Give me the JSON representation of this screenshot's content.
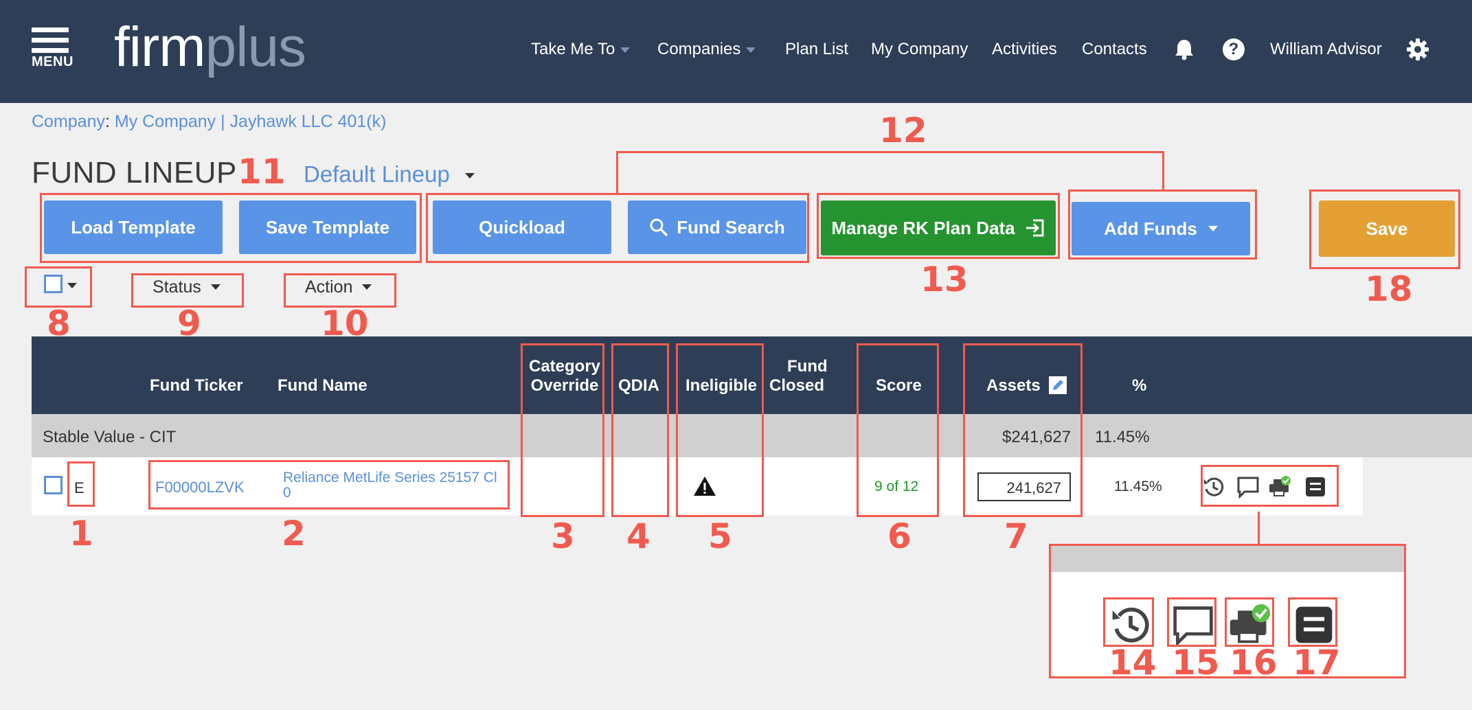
{
  "header": {
    "menu_label": "MENU",
    "logo_firm": "firm",
    "logo_plus": "plus",
    "nav": {
      "take_me_to": "Take Me To",
      "companies": "Companies",
      "plan_list": "Plan List",
      "my_company": "My Company",
      "activities": "Activities",
      "contacts": "Contacts",
      "user": "William Advisor"
    },
    "help_glyph": "?",
    "icons": [
      "menu-icon",
      "bell-icon",
      "help-icon",
      "gear-icon"
    ]
  },
  "breadcrumb": {
    "label": "Company",
    "separator": ":",
    "value": "My Company | Jayhawk LLC 401(k)"
  },
  "page": {
    "title": "FUND LINEUP",
    "lineup_selector": "Default Lineup"
  },
  "toolbar": {
    "load_template": "Load Template",
    "save_template": "Save Template",
    "quickload": "Quickload",
    "fund_search": "Fund Search",
    "manage_rk": "Manage RK Plan Data",
    "add_funds": "Add Funds",
    "save": "Save"
  },
  "filters": {
    "status": "Status",
    "action": "Action"
  },
  "table": {
    "headers": {
      "ticker": "Fund Ticker",
      "name": "Fund Name",
      "category_override_1": "Category",
      "category_override_2": "Override",
      "qdia": "QDIA",
      "ineligible": "Ineligible",
      "fund_closed_1": "Fund",
      "fund_closed_2": "Closed",
      "score": "Score",
      "assets": "Assets",
      "percent": "%"
    },
    "group": {
      "name": "Stable Value - CIT",
      "assets": "$241,627",
      "percent": "11.45%"
    },
    "rows": [
      {
        "flag": "E",
        "ticker": "F00000LZVK",
        "name_line1": "Reliance MetLife Series 25157 Cl",
        "name_line2": "0",
        "ineligible_icon": "warning-icon",
        "score": "9 of 12",
        "assets": "241,627",
        "percent": "11.45%",
        "row_icons": [
          "history-icon",
          "comment-icon",
          "print-check-icon",
          "details-icon"
        ]
      }
    ]
  },
  "annotation_numbers": {
    "n1": "1",
    "n2": "2",
    "n3": "3",
    "n4": "4",
    "n5": "5",
    "n6": "6",
    "n7": "7",
    "n8": "8",
    "n9": "9",
    "n10": "10",
    "n11": "11",
    "n12": "12",
    "n13": "13",
    "n14": "14",
    "n15": "15",
    "n16": "16",
    "n17": "17",
    "n18": "18"
  },
  "colors": {
    "header_bg": "#2e3e56",
    "primary_button": "#5a94e6",
    "green_button": "#25932f",
    "save_button": "#e4a033",
    "link": "#5b8fd8",
    "annotation": "#f05a4f",
    "score_text": "#25932f"
  }
}
